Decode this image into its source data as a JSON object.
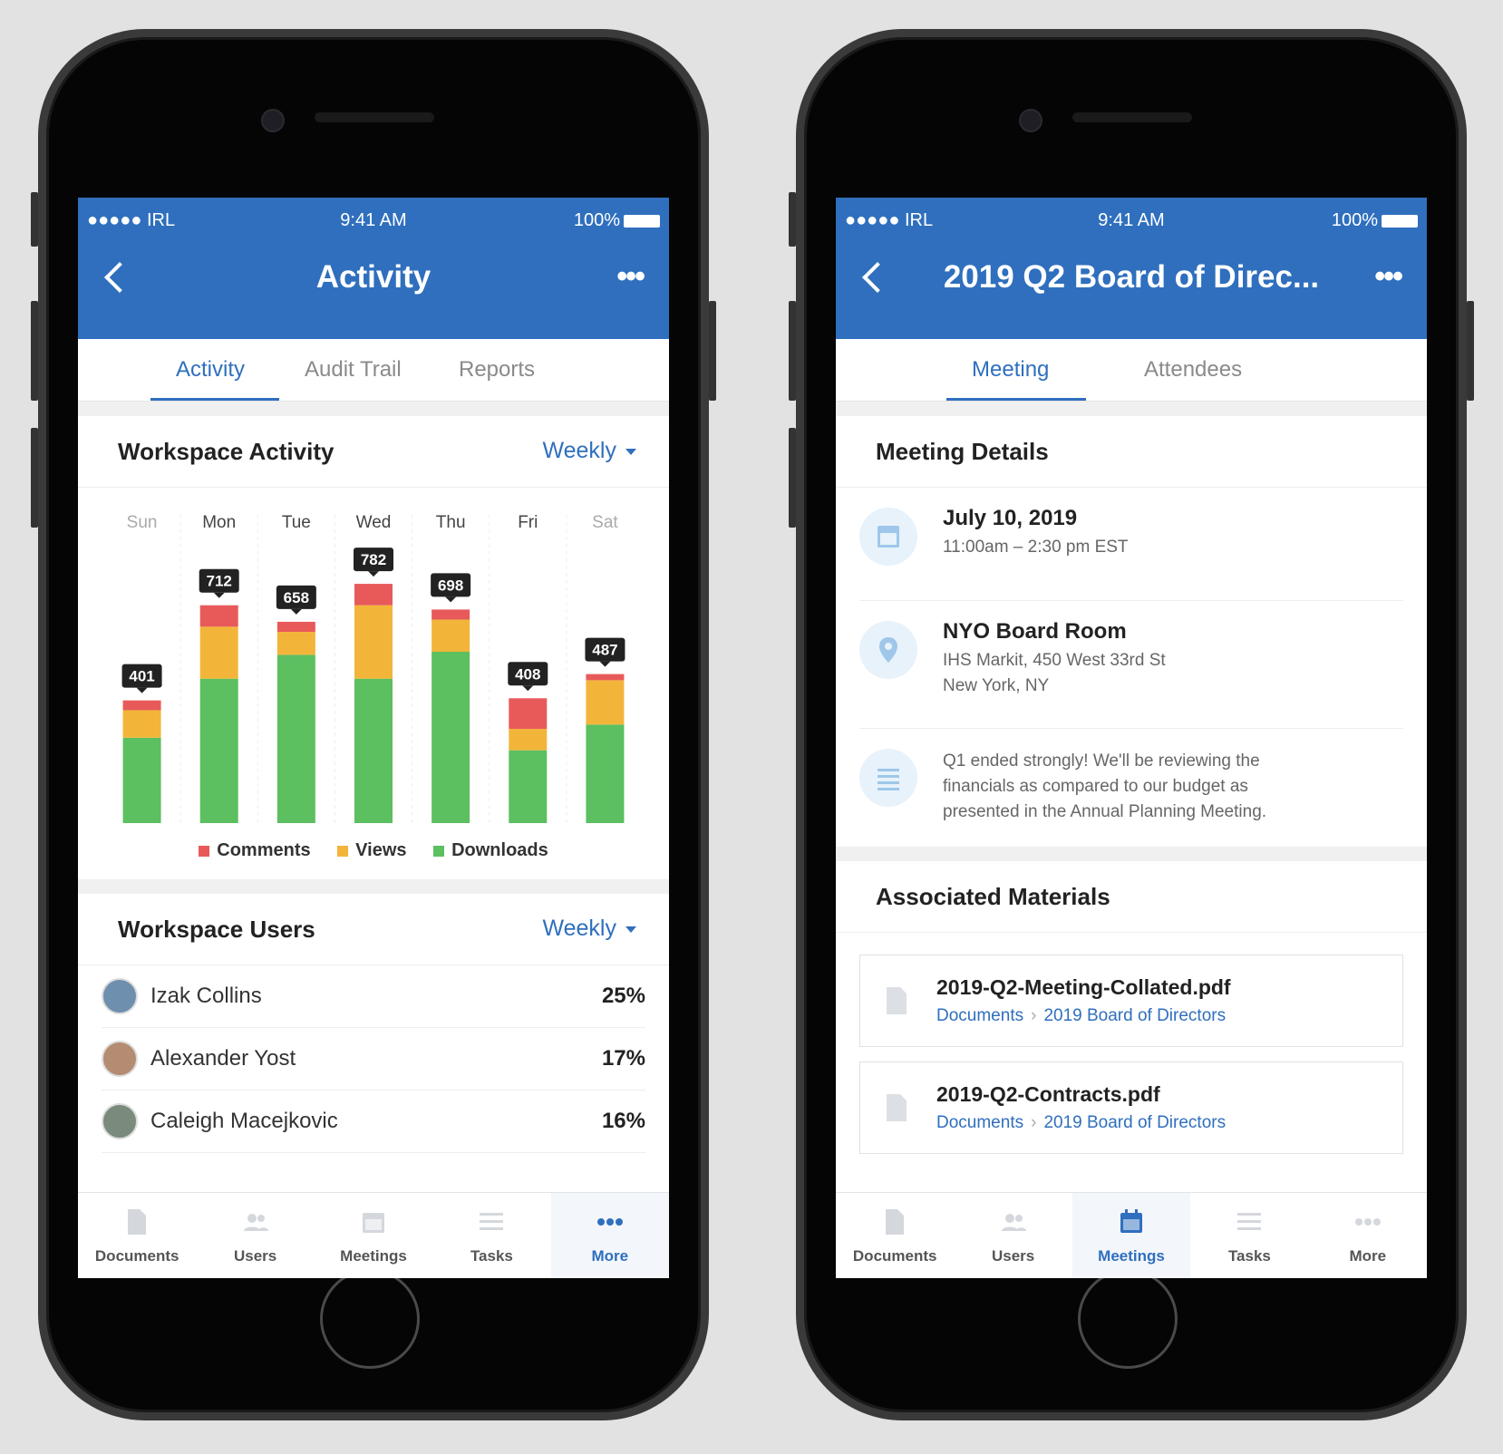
{
  "status_bar": {
    "carrier": "●●●●● IRL",
    "time": "9:41 AM",
    "battery": "100%"
  },
  "left": {
    "title": "Activity",
    "tabs": [
      {
        "label": "Activity",
        "active": true
      },
      {
        "label": "Audit Trail",
        "active": false
      },
      {
        "label": "Reports",
        "active": false
      }
    ],
    "activity_section": {
      "title": "Workspace Activity",
      "period": "Weekly"
    },
    "users_section": {
      "title": "Workspace Users",
      "period": "Weekly"
    },
    "users": [
      {
        "name": "Izak Collins",
        "percent": "25%"
      },
      {
        "name": "Alexander Yost",
        "percent": "17%"
      },
      {
        "name": "Caleigh Macejkovic",
        "percent": "16%"
      }
    ]
  },
  "right": {
    "title": "2019 Q2 Board of Direc...",
    "tabs": [
      {
        "label": "Meeting",
        "active": true
      },
      {
        "label": "Attendees",
        "active": false
      }
    ],
    "details_title": "Meeting Details",
    "date": {
      "main": "July 10, 2019",
      "sub": "11:00am – 2:30 pm EST"
    },
    "location": {
      "main": "NYO Board Room",
      "line1": "IHS Markit, 450 West 33rd St",
      "line2": "New York, NY"
    },
    "notes": {
      "line1": "Q1 ended strongly! We'll be reviewing the",
      "line2": "financials as compared to our budget as",
      "line3": "presented in the Annual Planning Meeting."
    },
    "materials_title": "Associated Materials",
    "materials": [
      {
        "name": "2019-Q2-Meeting-Collated.pdf",
        "crumb1": "Documents",
        "crumb2": "2019 Board of Directors"
      },
      {
        "name": "2019-Q2-Contracts.pdf",
        "crumb1": "Documents",
        "crumb2": "2019 Board of Directors"
      }
    ]
  },
  "bottom_tabs": [
    "Documents",
    "Users",
    "Meetings",
    "Tasks",
    "More"
  ],
  "left_selected_tab": "More",
  "right_selected_tab": "Meetings",
  "colors": {
    "brand": "#2f6fbe",
    "comments": "#e85a5a",
    "views": "#f2b53a",
    "downloads": "#5cbf60"
  },
  "icons": {
    "back": "chevron-left-icon",
    "more": "ellipsis-icon",
    "calendar": "calendar-icon",
    "location": "location-pin-icon",
    "notes": "notes-icon",
    "file": "file-icon"
  },
  "chart_data": {
    "type": "bar",
    "stacked": true,
    "categories": [
      "Sun",
      "Mon",
      "Tue",
      "Wed",
      "Thu",
      "Fri",
      "Sat"
    ],
    "series": [
      {
        "name": "Comments",
        "values": [
          32,
          70,
          33,
          70,
          33,
          100,
          20
        ]
      },
      {
        "name": "Views",
        "values": [
          90,
          170,
          75,
          240,
          105,
          70,
          145
        ]
      },
      {
        "name": "Downloads",
        "values": [
          279,
          472,
          550,
          472,
          560,
          238,
          322
        ]
      }
    ],
    "totals": [
      401,
      712,
      658,
      782,
      698,
      408,
      487
    ],
    "ylim": [
      0,
      800
    ],
    "legend": "bottom"
  }
}
